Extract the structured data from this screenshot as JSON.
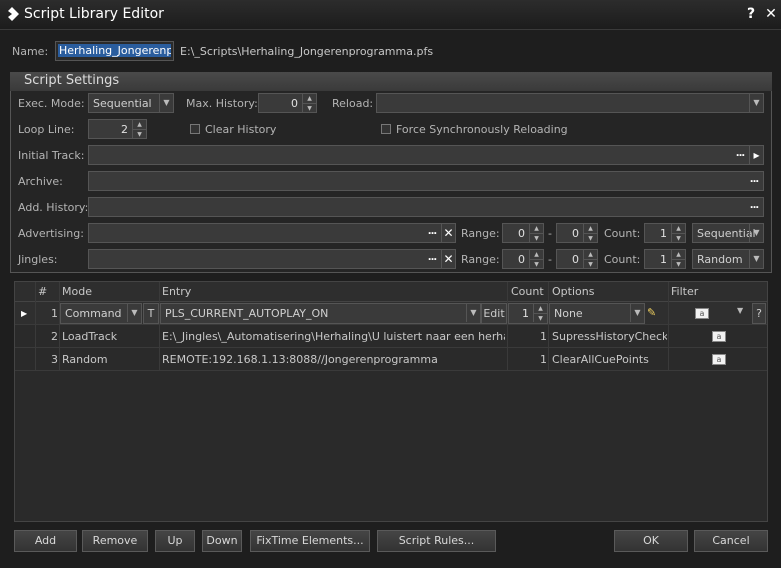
{
  "window": {
    "title": "Script Library Editor",
    "help_label": "?",
    "close_label": "✕"
  },
  "name_row": {
    "label": "Name:",
    "value": "Herhaling_Jongerenprog",
    "path": "E:\\_Scripts\\Herhaling_Jongerenprogramma.pfs"
  },
  "settings": {
    "title": "Script Settings",
    "exec_mode_label": "Exec. Mode:",
    "exec_mode_value": "Sequential",
    "max_history_label": "Max. History:",
    "max_history_value": "0",
    "reload_label": "Reload:",
    "reload_value": "",
    "loop_line_label": "Loop Line:",
    "loop_line_value": "2",
    "clear_history_label": "Clear History",
    "force_sync_label": "Force Synchronously Reloading",
    "initial_track_label": "Initial Track:",
    "archive_label": "Archive:",
    "add_history_label": "Add. History:",
    "advertising_label": "Advertising:",
    "jingles_label": "Jingles:",
    "range_label": "Range:",
    "dash": "-",
    "count_label": "Count:",
    "dots": "...",
    "advertising": {
      "range_from": "0",
      "range_to": "0",
      "count": "1",
      "mode": "Sequential"
    },
    "jingles": {
      "range_from": "0",
      "range_to": "0",
      "count": "1",
      "mode": "Random"
    }
  },
  "grid": {
    "columns": [
      "#",
      "Mode",
      "Entry",
      "Count",
      "Options",
      "Filter"
    ],
    "edit_label": "Edit",
    "t_label": "T",
    "question_label": "?",
    "rows": [
      {
        "num": "1",
        "mode": "Command",
        "entry": "PLS_CURRENT_AUTOPLAY_ON",
        "count": "1",
        "options": "None"
      },
      {
        "num": "2",
        "mode": "LoadTrack",
        "entry": "E:\\_Jingles\\_Automatisering\\Herhaling\\U luistert naar een herhaling ...",
        "count": "1",
        "options": "SupressHistoryCheck..."
      },
      {
        "num": "3",
        "mode": "Random",
        "entry": "REMOTE:192.168.1.13:8088//Jongerenprogramma",
        "count": "1",
        "options": "ClearAllCuePoints"
      }
    ]
  },
  "buttons": {
    "add": "Add",
    "remove": "Remove",
    "up": "Up",
    "down": "Down",
    "fixtime": "FixTime Elements...",
    "script_rules": "Script Rules...",
    "ok": "OK",
    "cancel": "Cancel"
  }
}
